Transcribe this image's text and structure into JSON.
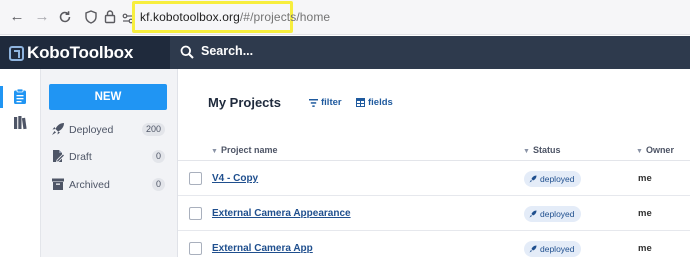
{
  "browser": {
    "url_host": "kf.kobotoolbox.org",
    "url_path": "/#/projects/home"
  },
  "header": {
    "logo_text": "KoboToolbox",
    "search_placeholder": "Search..."
  },
  "sidebar": {
    "new_label": "NEW",
    "items": [
      {
        "label": "Deployed",
        "count": "200",
        "icon": "rocket-icon"
      },
      {
        "label": "Draft",
        "count": "0",
        "icon": "draft-icon"
      },
      {
        "label": "Archived",
        "count": "0",
        "icon": "archive-icon"
      }
    ]
  },
  "main": {
    "title": "My Projects",
    "filter_label": "filter",
    "fields_label": "fields",
    "columns": [
      "Project name",
      "Status",
      "Owner"
    ],
    "rows": [
      {
        "name": "V4 - Copy",
        "status": "deployed",
        "owner": "me"
      },
      {
        "name": "External Camera Appearance",
        "status": "deployed",
        "owner": "me"
      },
      {
        "name": "External Camera App",
        "status": "deployed",
        "owner": "me"
      }
    ]
  },
  "colors": {
    "header_bg": "#1f2a3c",
    "accent": "#2095f3",
    "link": "#1f4f8e",
    "highlight": "#f7ee3e"
  }
}
